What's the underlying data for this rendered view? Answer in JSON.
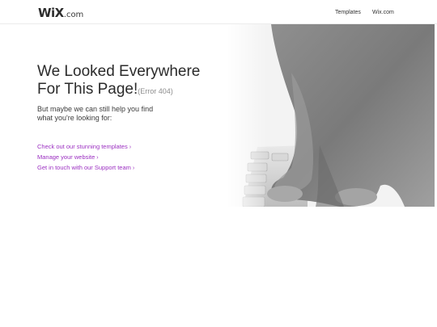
{
  "header": {
    "logo_main": "WiX",
    "logo_suffix": ".com",
    "nav": [
      "Templates",
      "Wix.com"
    ]
  },
  "main": {
    "title_line1": "We Looked Everywhere",
    "title_line2": "For This Page!",
    "error_code": "(Error 404)",
    "subtitle_line1": "But maybe we can still help you find",
    "subtitle_line2": "what you're looking for:",
    "links": [
      "Check out our stunning templates",
      "Manage your website",
      "Get in touch with our Support team"
    ],
    "chevron": "›"
  },
  "colors": {
    "link": "#9b2fc1",
    "text": "#2b2b2b"
  }
}
